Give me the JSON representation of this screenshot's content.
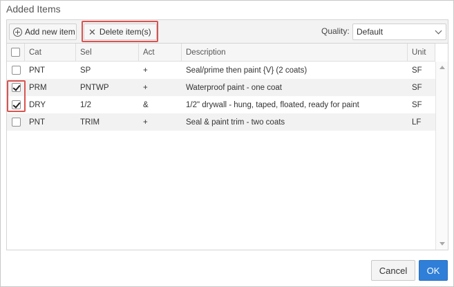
{
  "dialog": {
    "title": "Added Items"
  },
  "toolbar": {
    "add_label": "Add new item",
    "delete_label": "Delete item(s)",
    "quality_label": "Quality:",
    "quality_value": "Default"
  },
  "table": {
    "headers": [
      "Cat",
      "Sel",
      "Act",
      "Description",
      "Unit"
    ],
    "rows": [
      {
        "checked": false,
        "cat": "PNT",
        "sel": "SP",
        "act": "+",
        "description": "Seal/prime then paint {V} (2 coats)",
        "unit": "SF"
      },
      {
        "checked": true,
        "cat": "PRM",
        "sel": "PNTWP",
        "act": "+",
        "description": "Waterproof paint - one coat",
        "unit": "SF"
      },
      {
        "checked": true,
        "cat": "DRY",
        "sel": "1/2",
        "act": "&",
        "description": "1/2\" drywall - hung, taped, floated, ready for paint",
        "unit": "SF"
      },
      {
        "checked": false,
        "cat": "PNT",
        "sel": "TRIM",
        "act": "+",
        "description": "Seal & paint trim - two coats",
        "unit": "LF"
      }
    ]
  },
  "footer": {
    "cancel_label": "Cancel",
    "ok_label": "OK"
  },
  "icons": {
    "add": "circle-plus-icon",
    "delete": "close-icon",
    "dropdown": "chevron-down-icon"
  },
  "colors": {
    "primary": "#2f7fd8",
    "highlight": "#d9534f"
  }
}
